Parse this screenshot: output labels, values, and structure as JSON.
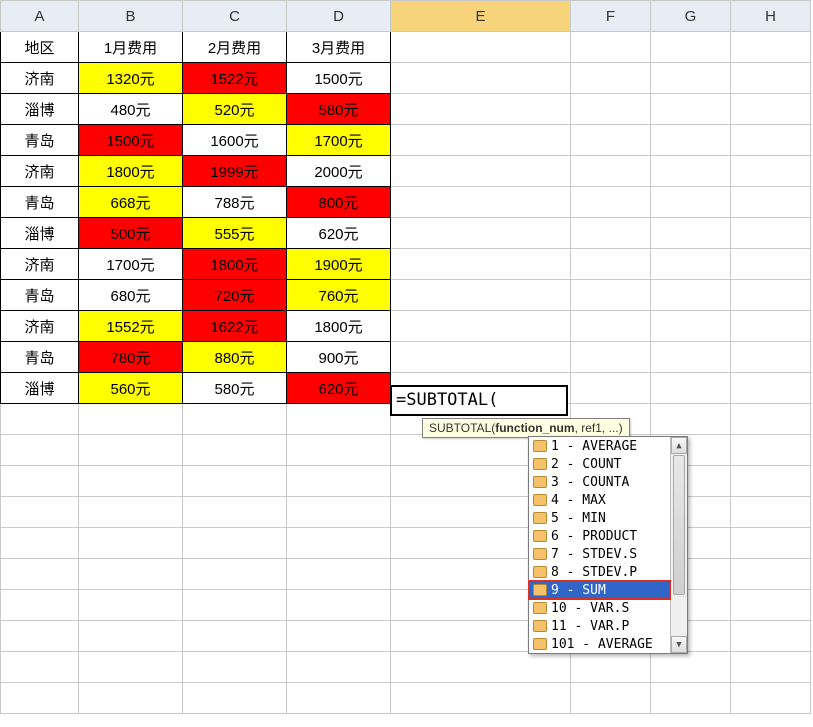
{
  "columns": [
    "A",
    "B",
    "C",
    "D",
    "E",
    "F",
    "G",
    "H"
  ],
  "active_column": "E",
  "headers": {
    "region": "地区",
    "m1": "1月费用",
    "m2": "2月费用",
    "m3": "3月费用"
  },
  "rows": [
    {
      "region": "济南",
      "m1": {
        "v": "1320元",
        "c": "yellow"
      },
      "m2": {
        "v": "1522元",
        "c": "red"
      },
      "m3": {
        "v": "1500元",
        "c": ""
      }
    },
    {
      "region": "淄博",
      "m1": {
        "v": "480元",
        "c": ""
      },
      "m2": {
        "v": "520元",
        "c": "yellow"
      },
      "m3": {
        "v": "580元",
        "c": "red"
      }
    },
    {
      "region": "青岛",
      "m1": {
        "v": "1500元",
        "c": "red"
      },
      "m2": {
        "v": "1600元",
        "c": ""
      },
      "m3": {
        "v": "1700元",
        "c": "yellow"
      }
    },
    {
      "region": "济南",
      "m1": {
        "v": "1800元",
        "c": "yellow"
      },
      "m2": {
        "v": "1999元",
        "c": "red"
      },
      "m3": {
        "v": "2000元",
        "c": ""
      }
    },
    {
      "region": "青岛",
      "m1": {
        "v": "668元",
        "c": "yellow"
      },
      "m2": {
        "v": "788元",
        "c": ""
      },
      "m3": {
        "v": "800元",
        "c": "red"
      }
    },
    {
      "region": "淄博",
      "m1": {
        "v": "500元",
        "c": "red"
      },
      "m2": {
        "v": "555元",
        "c": "yellow"
      },
      "m3": {
        "v": "620元",
        "c": ""
      }
    },
    {
      "region": "济南",
      "m1": {
        "v": "1700元",
        "c": ""
      },
      "m2": {
        "v": "1800元",
        "c": "red"
      },
      "m3": {
        "v": "1900元",
        "c": "yellow"
      }
    },
    {
      "region": "青岛",
      "m1": {
        "v": "680元",
        "c": ""
      },
      "m2": {
        "v": "720元",
        "c": "red"
      },
      "m3": {
        "v": "760元",
        "c": "yellow"
      }
    },
    {
      "region": "济南",
      "m1": {
        "v": "1552元",
        "c": "yellow"
      },
      "m2": {
        "v": "1622元",
        "c": "red"
      },
      "m3": {
        "v": "1800元",
        "c": ""
      }
    },
    {
      "region": "青岛",
      "m1": {
        "v": "780元",
        "c": "red"
      },
      "m2": {
        "v": "880元",
        "c": "yellow"
      },
      "m3": {
        "v": "900元",
        "c": ""
      }
    },
    {
      "region": "淄博",
      "m1": {
        "v": "560元",
        "c": "yellow"
      },
      "m2": {
        "v": "580元",
        "c": ""
      },
      "m3": {
        "v": "620元",
        "c": "red"
      }
    }
  ],
  "formula_input": "=SUBTOTAL(",
  "tooltip": {
    "fn": "SUBTOTAL(",
    "arg_active": "function_num",
    "rest": ", ref1, ...)"
  },
  "autocomplete": {
    "selected_index": 8,
    "items": [
      "1 - AVERAGE",
      "2 - COUNT",
      "3 - COUNTA",
      "4 - MAX",
      "5 - MIN",
      "6 - PRODUCT",
      "7 - STDEV.S",
      "8 - STDEV.P",
      "9 - SUM",
      "10 - VAR.S",
      "11 - VAR.P",
      "101 - AVERAGE"
    ]
  }
}
